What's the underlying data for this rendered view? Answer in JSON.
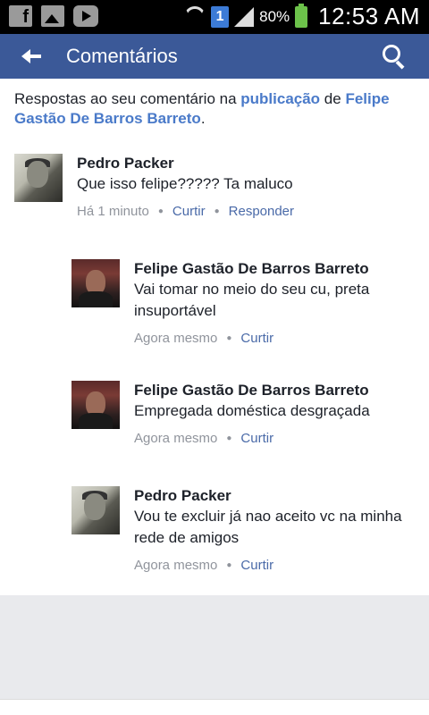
{
  "status_bar": {
    "battery_percent": "80%",
    "time": "12:53 AM",
    "sim_slot": "1"
  },
  "app_bar": {
    "title": "Comentários"
  },
  "header": {
    "prefix": "Respostas ao seu comentário na ",
    "link_post": "publicação",
    "middle": " de ",
    "link_author": "Felipe Gastão De Barros Barreto",
    "suffix": "."
  },
  "comments": [
    {
      "name": "Pedro Packer",
      "text": "Que isso felipe????? Ta maluco",
      "time": "Há 1 minuto",
      "actions": [
        "Curtir",
        "Responder"
      ]
    },
    {
      "name": "Felipe Gastão De Barros Barreto",
      "text": "Vai tomar no meio do seu cu, preta insuportável",
      "time": "Agora mesmo",
      "actions": [
        "Curtir"
      ]
    },
    {
      "name": "Felipe Gastão De Barros Barreto",
      "text": "Empregada doméstica desgraçada",
      "time": "Agora mesmo",
      "actions": [
        "Curtir"
      ]
    },
    {
      "name": "Pedro Packer",
      "text": "Vou te excluir já  nao aceito vc na minha rede de amigos",
      "time": "Agora mesmo",
      "actions": [
        "Curtir"
      ]
    }
  ],
  "icons": {
    "back": "back-arrow-icon",
    "search": "search-icon",
    "facebook": "facebook-icon",
    "gallery": "gallery-icon",
    "youtube": "youtube-icon",
    "wifi": "wifi-icon",
    "signal": "signal-icon",
    "battery": "battery-icon"
  },
  "colors": {
    "app_bar": "#3b5998",
    "link": "#4a7ac9",
    "meta": "#90949c"
  }
}
